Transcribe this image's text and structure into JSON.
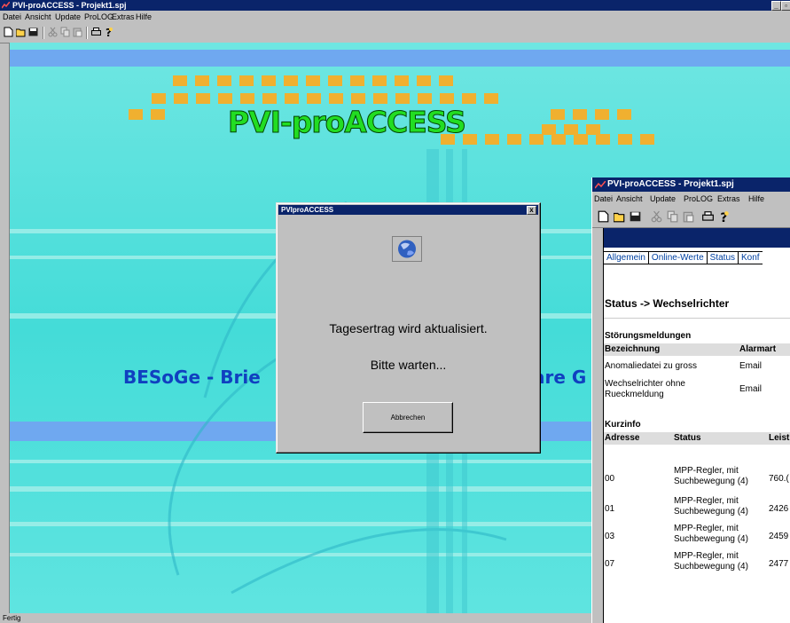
{
  "main_window": {
    "title": "PVI-proACCESS - Projekt1.spj",
    "menu": [
      "Datei",
      "Ansicht",
      "Update",
      "ProLOG",
      "Extras",
      "Hilfe"
    ],
    "status_text": "Fertig"
  },
  "background": {
    "banner": "PVI-proACCESS",
    "subtitle_left": "BESoGe - Brie",
    "subtitle_right": "are G"
  },
  "dialog": {
    "title": "PVIproACCESS",
    "message": "Tagesertrag wird aktualisiert.",
    "wait": "Bitte warten...",
    "cancel_label": "Abbrechen",
    "close_glyph": "x"
  },
  "second_window": {
    "title": "PVI-proACCESS - Projekt1.spj",
    "menu": [
      "Datei",
      "Ansicht",
      "Update",
      "ProLOG",
      "Extras",
      "Hilfe"
    ],
    "tabs": [
      "Allgemein",
      "Online-Werte",
      "Status",
      "Konf"
    ],
    "heading": "Status -> Wechselrichter",
    "faults": {
      "title": "Störungsmeldungen",
      "headers": [
        "Bezeichnung",
        "Alarmart"
      ],
      "rows": [
        [
          "Anomaliedatei zu gross",
          "Email"
        ],
        [
          "Wechselrichter ohne Rueckmeldung",
          "Email"
        ]
      ]
    },
    "kurzinfo": {
      "title": "Kurzinfo",
      "headers": [
        "Adresse",
        "Status",
        "Leist"
      ],
      "rows": [
        [
          "00",
          "MPP-Regler, mit Suchbewegung (4)",
          "760.("
        ],
        [
          "01",
          "MPP-Regler, mit Suchbewegung (4)",
          "2426"
        ],
        [
          "03",
          "MPP-Regler, mit Suchbewegung (4)",
          "2459"
        ],
        [
          "07",
          "MPP-Regler, mit Suchbewegung (4)",
          "2477"
        ]
      ]
    }
  },
  "colors": {
    "titlebar": "#0a246a",
    "background_cyan": "#40e0e0",
    "banner_green": "#22dd22",
    "stripe_blue": "#6fa8f0",
    "orange": "#f0b030"
  }
}
